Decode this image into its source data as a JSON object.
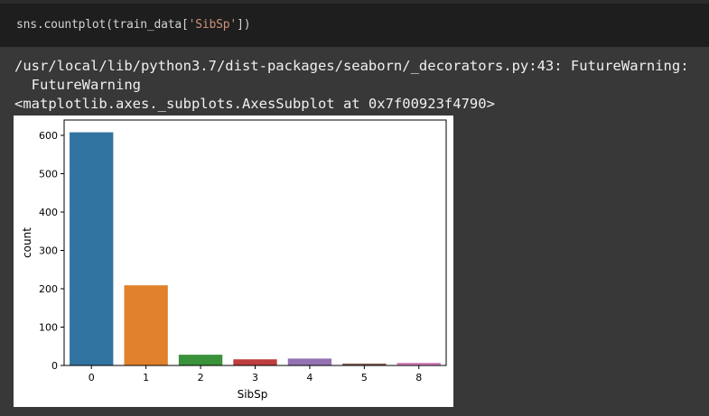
{
  "code_cell": {
    "prefix": "sns.countplot(train_data[",
    "string": "'SibSp'",
    "suffix": "])"
  },
  "output": {
    "warning_line": "/usr/local/lib/python3.7/dist-packages/seaborn/_decorators.py:43: FutureWarning:",
    "warning_cont": "  FutureWarning",
    "repr_line": "<matplotlib.axes._subplots.AxesSubplot at 0x7f00923f4790>"
  },
  "chart_data": {
    "type": "bar",
    "categories": [
      "0",
      "1",
      "2",
      "3",
      "4",
      "5",
      "8"
    ],
    "values": [
      608,
      209,
      28,
      16,
      18,
      5,
      7
    ],
    "colors": [
      "#3274a1",
      "#e1812c",
      "#3a923a",
      "#c03d3e",
      "#9372b2",
      "#845b53",
      "#d684bd"
    ],
    "xlabel": "SibSp",
    "ylabel": "count",
    "ylim": [
      0,
      640
    ],
    "yticks": [
      0,
      100,
      200,
      300,
      400,
      500,
      600
    ],
    "grid": false
  }
}
